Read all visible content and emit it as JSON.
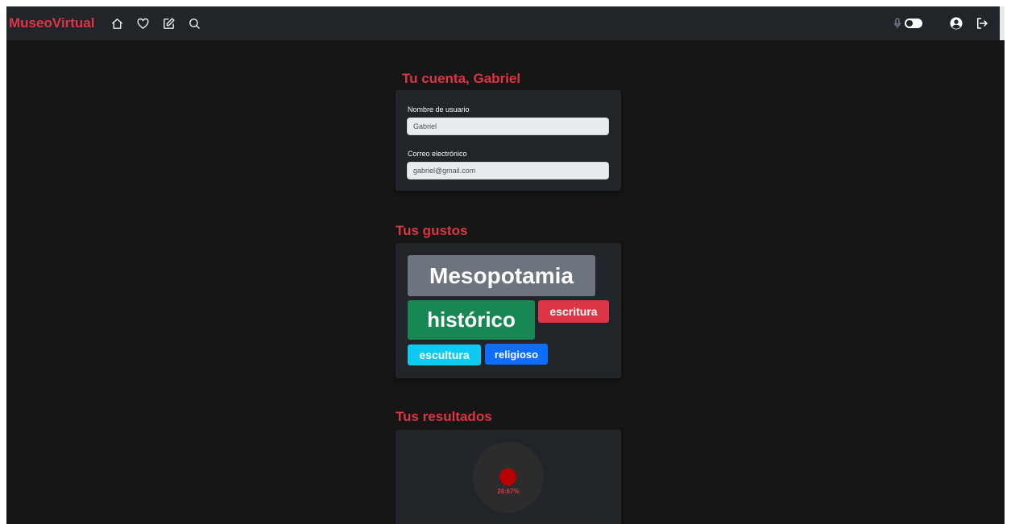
{
  "navbar": {
    "brand": "MuseoVirtual",
    "icons": [
      "home-icon",
      "heart-icon",
      "edit-icon",
      "search-icon"
    ],
    "right_icons": [
      "microphone-icon",
      "toggle-switch",
      "user-circle-icon",
      "logout-icon"
    ]
  },
  "account": {
    "title": "Tu cuenta, Gabriel",
    "username_label": "Nombre de usuario",
    "username_value": "Gabriel",
    "email_label": "Correo electrónico",
    "email_value": "gabriel@gmail.com"
  },
  "likes": {
    "title": "Tus gustos",
    "tags": [
      {
        "label": "Mesopotamia",
        "color": "#6c757d"
      },
      {
        "label": "histórico",
        "color": "#198754"
      },
      {
        "label": "escritura",
        "color": "#dc3545"
      },
      {
        "label": "escultura",
        "color": "#0dcaf0"
      },
      {
        "label": "religioso",
        "color": "#0d6efd"
      }
    ]
  },
  "results": {
    "title": "Tus resultados",
    "percentage": "26.67%"
  },
  "colors": {
    "accent": "#dc3545",
    "navbar_bg": "#212529",
    "page_bg": "#161616",
    "card_bg": "#212529"
  }
}
